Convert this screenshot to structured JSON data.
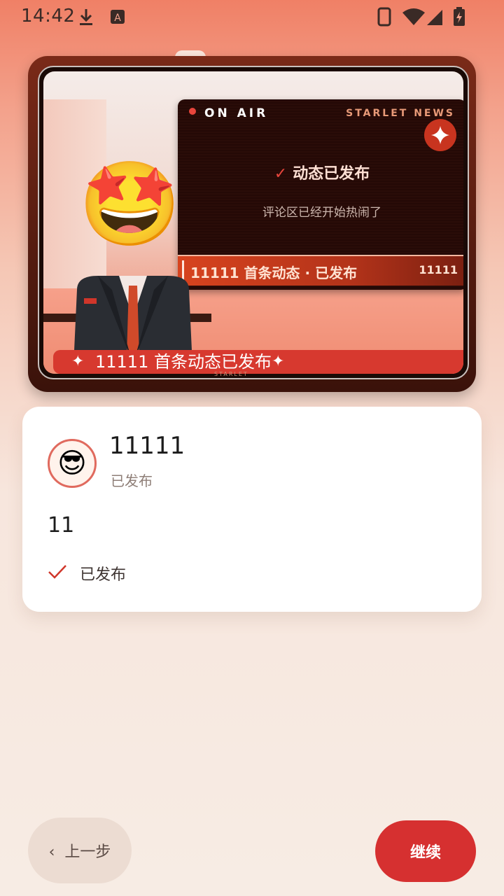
{
  "status_bar": {
    "time": "14:42",
    "icons": [
      "download-icon",
      "font-app-icon",
      "phone-icon",
      "wifi-icon",
      "signal-icon",
      "battery-icon"
    ]
  },
  "tv": {
    "on_air": "ON AIR",
    "brand": "STARLET NEWS",
    "headline": "动态已发布",
    "subline": "评论区已经开始热闹了",
    "ticker_text": "11111 首条动态 · 已发布",
    "ticker_right": "11111",
    "banner": "11111 首条动态已发布",
    "brand_tag": "STARLET",
    "anchor_emoji": "🤩"
  },
  "post": {
    "avatar_emoji": "😎",
    "username": "11111",
    "status": "已发布",
    "content": "11",
    "published_label": "已发布"
  },
  "nav": {
    "back_label": "上一步",
    "next_label": "继续"
  },
  "colors": {
    "accent": "#d63030",
    "tv_frame": "#7a2a18",
    "ticker": "#d7431e"
  }
}
